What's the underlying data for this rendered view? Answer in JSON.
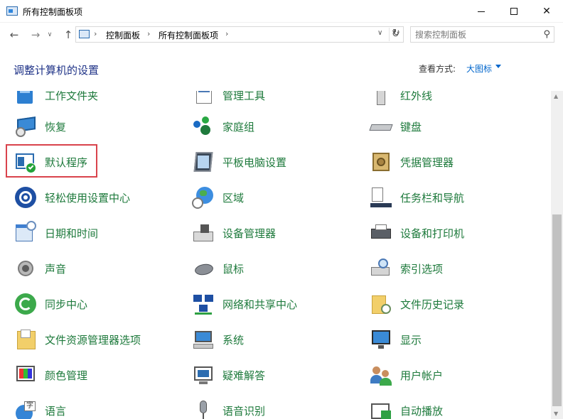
{
  "window": {
    "title": "所有控制面板项",
    "icon": "control-panel-icon"
  },
  "nav": {
    "breadcrumb": [
      "控制面板",
      "所有控制面板项"
    ],
    "search_placeholder": "搜索控制面板"
  },
  "header": {
    "title": "调整计算机的设置",
    "view_label": "查看方式:",
    "view_value": "大图标"
  },
  "colors": {
    "link_green": "#1e7a3c",
    "heading_blue": "#1e3287",
    "link_blue": "#0066cc",
    "highlight_red": "#d9434c"
  },
  "items": {
    "col1": [
      "工作文件夹",
      "恢复",
      "默认程序",
      "轻松使用设置中心",
      "日期和时间",
      "声音",
      "同步中心",
      "文件资源管理器选项",
      "颜色管理",
      "语言"
    ],
    "col2": [
      "管理工具",
      "家庭组",
      "平板电脑设置",
      "区域",
      "设备管理器",
      "鼠标",
      "网络和共享中心",
      "系统",
      "疑难解答",
      "语音识别"
    ],
    "col3": [
      "红外线",
      "键盘",
      "凭据管理器",
      "任务栏和导航",
      "设备和打印机",
      "索引选项",
      "文件历史记录",
      "显示",
      "用户帐户",
      "自动播放"
    ]
  },
  "highlighted_item": "默认程序"
}
